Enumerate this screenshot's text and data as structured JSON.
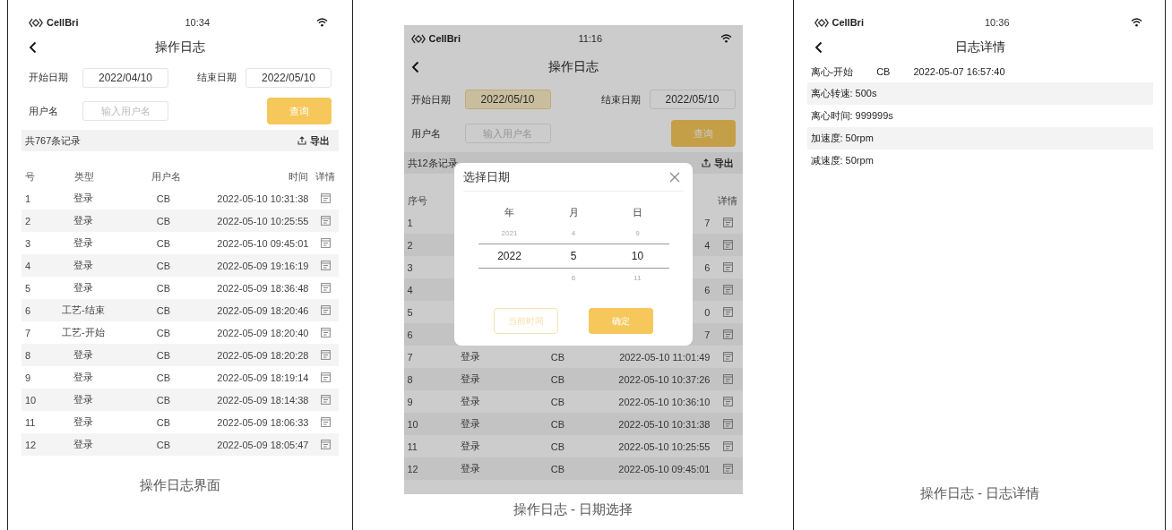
{
  "panels": [
    {
      "kind": "log_list",
      "status_bar": {
        "brand": "CellBri",
        "time": "10:34"
      },
      "title": "操作日志",
      "filters": {
        "start_label": "开始日期",
        "start_date": {
          "value": "2022/04/10",
          "focused": false
        },
        "end_label": "结束日期",
        "end_date": {
          "value": "2022/05/10",
          "focused": false
        },
        "user_label": "用户名",
        "user_placeholder": "输入用户名",
        "query_button": "查询"
      },
      "record_count": "共767条记录",
      "export_button": "导出",
      "table": {
        "columns": {
          "seq": "号",
          "type": "类型",
          "user": "用户名",
          "time": "时间",
          "detail": "详情"
        },
        "rows": [
          {
            "seq": "1",
            "type": "登录",
            "user": "CB",
            "time": "2022-05-10 10:31:38"
          },
          {
            "seq": "2",
            "type": "登录",
            "user": "CB",
            "time": "2022-05-10 10:25:55"
          },
          {
            "seq": "3",
            "type": "登录",
            "user": "CB",
            "time": "2022-05-10 09:45:01"
          },
          {
            "seq": "4",
            "type": "登录",
            "user": "CB",
            "time": "2022-05-09 19:16:19"
          },
          {
            "seq": "5",
            "type": "登录",
            "user": "CB",
            "time": "2022-05-09 18:36:48"
          },
          {
            "seq": "6",
            "type": "工艺-结束",
            "user": "CB",
            "time": "2022-05-09 18:20:46"
          },
          {
            "seq": "7",
            "type": "工艺-开始",
            "user": "CB",
            "time": "2022-05-09 18:20:40"
          },
          {
            "seq": "8",
            "type": "登录",
            "user": "CB",
            "time": "2022-05-09 18:20:28"
          },
          {
            "seq": "9",
            "type": "登录",
            "user": "CB",
            "time": "2022-05-09 18:19:14"
          },
          {
            "seq": "10",
            "type": "登录",
            "user": "CB",
            "time": "2022-05-09 18:14:38"
          },
          {
            "seq": "11",
            "type": "登录",
            "user": "CB",
            "time": "2022-05-09 18:06:33"
          },
          {
            "seq": "12",
            "type": "登录",
            "user": "CB",
            "time": "2022-05-09 18:05:47"
          }
        ]
      },
      "caption": "操作日志界面"
    },
    {
      "kind": "log_list",
      "dimmed": true,
      "status_bar": {
        "brand": "CellBri",
        "time": "11:16"
      },
      "title": "操作日志",
      "filters": {
        "start_label": "开始日期",
        "start_date": {
          "value": "2022/05/10",
          "focused": true
        },
        "end_label": "结束日期",
        "end_date": {
          "value": "2022/05/10",
          "focused": false
        },
        "user_label": "用户名",
        "user_placeholder": "输入用户名",
        "query_button": "查询"
      },
      "record_count": "共12条记录",
      "export_button": "导出",
      "table": {
        "columns": {
          "seq": "序号",
          "detail": "详情"
        },
        "rows": [
          {
            "seq": "1",
            "time": "7"
          },
          {
            "seq": "2",
            "time": "4"
          },
          {
            "seq": "3",
            "time": "6"
          },
          {
            "seq": "4",
            "time": "6"
          },
          {
            "seq": "5",
            "time": "0"
          },
          {
            "seq": "6",
            "time": "7"
          },
          {
            "seq": "7",
            "type": "登录",
            "user": "CB",
            "time": "2022-05-10 11:01:49"
          },
          {
            "seq": "8",
            "type": "登录",
            "user": "CB",
            "time": "2022-05-10 10:37:26"
          },
          {
            "seq": "9",
            "type": "登录",
            "user": "CB",
            "time": "2022-05-10 10:36:10"
          },
          {
            "seq": "10",
            "type": "登录",
            "user": "CB",
            "time": "2022-05-10 10:31:38"
          },
          {
            "seq": "11",
            "type": "登录",
            "user": "CB",
            "time": "2022-05-10 10:25:55"
          },
          {
            "seq": "12",
            "type": "登录",
            "user": "CB",
            "time": "2022-05-10 09:45:01"
          }
        ]
      },
      "dialog": {
        "title": "选择日期",
        "wheels": [
          {
            "label": "年",
            "options": [
              {
                "text": "2021",
                "selected": false
              },
              {
                "text": "2022",
                "selected": true
              }
            ]
          },
          {
            "label": "月",
            "options": [
              {
                "text": "4",
                "selected": false
              },
              {
                "text": "5",
                "selected": true
              },
              {
                "text": "6",
                "selected": false
              }
            ]
          },
          {
            "label": "日",
            "options": [
              {
                "text": "9",
                "selected": false
              },
              {
                "text": "10",
                "selected": true
              },
              {
                "text": "11",
                "selected": false
              }
            ]
          }
        ],
        "buttons": [
          {
            "label": "当前时间",
            "kind": "secondary"
          },
          {
            "label": "确定",
            "kind": "primary"
          }
        ]
      },
      "caption": "操作日志 - 日期选择"
    },
    {
      "kind": "log_detail",
      "status_bar": {
        "brand": "CellBri",
        "time": "10:36"
      },
      "title": "日志详情",
      "entry": {
        "type": "离心-开始",
        "user": "CB",
        "time": "2022-05-07 16:57:40"
      },
      "details": [
        "离心转速: 500s",
        "离心时间: 999999s",
        "加速度: 50rpm",
        "减速度: 50rpm"
      ],
      "caption": "操作日志 - 日志详情"
    }
  ]
}
